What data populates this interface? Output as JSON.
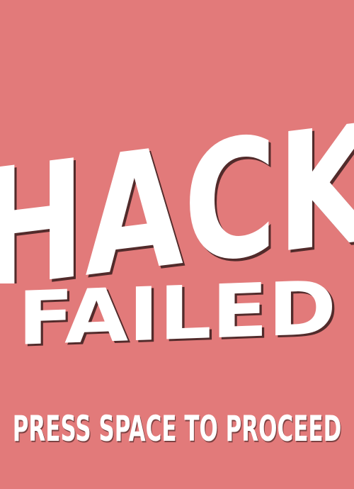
{
  "screen": {
    "background": "#e27a7a",
    "title_line1": "HACK",
    "title_line2": "FAILED",
    "prompt": "PRESS SPACE TO PROCEED"
  },
  "colors": {
    "text": "#ffffff",
    "shadow": "#3a1e1e"
  }
}
